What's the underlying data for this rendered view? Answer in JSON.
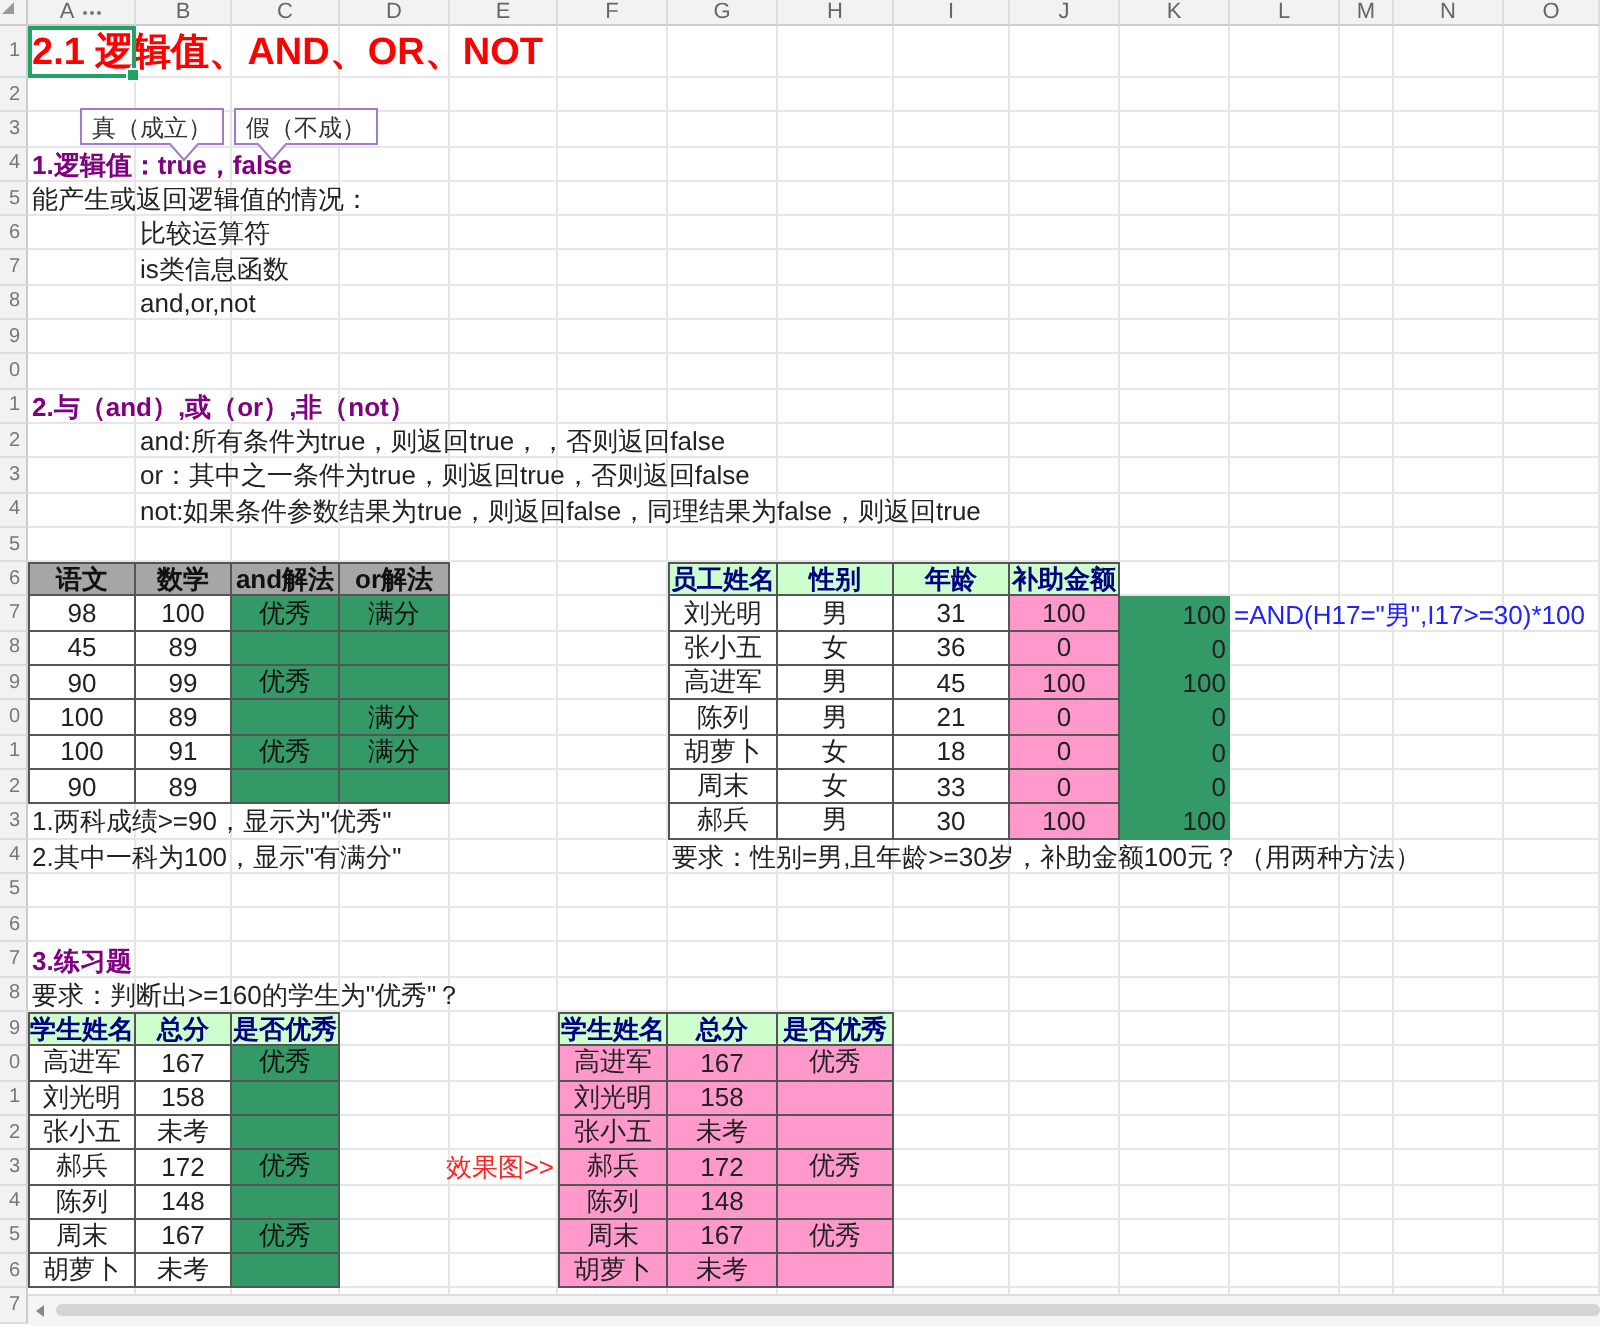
{
  "sheet": {
    "column_headers": [
      "A",
      "B",
      "C",
      "D",
      "E",
      "F",
      "G",
      "H",
      "I",
      "J",
      "K",
      "L",
      "M",
      "N",
      "O"
    ],
    "row_headers": [
      "1",
      "2",
      "3",
      "4",
      "5",
      "6",
      "7",
      "8",
      "9",
      "0",
      "1",
      "2",
      "3",
      "4",
      "5",
      "6",
      "7",
      "8",
      "9",
      "0",
      "1",
      "2",
      "3",
      "4",
      "5",
      "6",
      "7",
      "8",
      "9",
      "0",
      "1",
      "2",
      "3",
      "4",
      "5",
      "6",
      "7"
    ]
  },
  "title": {
    "text": "2.1 逻辑值、AND、OR、NOT",
    "selected": true
  },
  "callouts": [
    "真（成立）",
    "假（不成）"
  ],
  "section_1": {
    "heading": "1.逻辑值：true，false",
    "intro": "能产生或返回逻辑值的情况：",
    "items": [
      "比较运算符",
      "is类信息函数",
      "and,or,not"
    ]
  },
  "section_2": {
    "heading": "2.与（and）,或（or）,非（not）",
    "items": [
      "and:所有条件为true，则返回true，，否则返回false",
      "or：其中之一条件为true，则返回true，否则返回false",
      "not:如果条件参数结果为true，则返回false，同理结果为false，则返回true"
    ]
  },
  "score_table": {
    "columns": [
      "语文",
      "数学",
      "and解法",
      "or解法"
    ],
    "rows": [
      {
        "chinese": "98",
        "math": "100",
        "and_result": "优秀",
        "or_result": "满分"
      },
      {
        "chinese": "45",
        "math": "89"
      },
      {
        "chinese": "90",
        "math": "99",
        "and_result": "优秀"
      },
      {
        "chinese": "100",
        "math": "89",
        "or_result": "满分"
      },
      {
        "chinese": "100",
        "math": "91",
        "and_result": "优秀",
        "or_result": "满分"
      },
      {
        "chinese": "90",
        "math": "89"
      }
    ],
    "notes": [
      "1.两科成绩>=90，显示为\"优秀\"",
      "2.其中一科为100，显示\"有满分\""
    ]
  },
  "allowance_table": {
    "columns": [
      "员工姓名",
      "性别",
      "年龄",
      "补助金额"
    ],
    "rows": [
      {
        "name": "刘光明",
        "gender": "男",
        "age": "31",
        "allowance": "100",
        "column_5": "100"
      },
      {
        "name": "张小五",
        "gender": "女",
        "age": "36",
        "allowance": "0",
        "column_5": "0"
      },
      {
        "name": "高进军",
        "gender": "男",
        "age": "45",
        "allowance": "100",
        "column_5": "100"
      },
      {
        "name": "陈列",
        "gender": "男",
        "age": "21",
        "allowance": "0",
        "column_5": "0"
      },
      {
        "name": "胡萝卜",
        "gender": "女",
        "age": "18",
        "allowance": "0",
        "column_5": "0"
      },
      {
        "name": "周末",
        "gender": "女",
        "age": "33",
        "allowance": "0",
        "column_5": "0"
      },
      {
        "name": "郝兵",
        "gender": "男",
        "age": "30",
        "allowance": "100",
        "column_5": "100"
      }
    ],
    "formula": "=AND(H17=\"男\",I17>=30)*100",
    "requirement": "要求：性别=男,且年龄>=30岁，补助金额100元？（用两种方法）"
  },
  "exercise": {
    "heading": "3.练习题",
    "requirement": "要求：判断出>=160的学生为\"优秀\"？",
    "table": {
      "columns": [
        "学生姓名",
        "总分",
        "是否优秀"
      ],
      "rows": [
        {
          "name": "高进军",
          "total": "167",
          "result": "优秀"
        },
        {
          "name": "刘光明",
          "total": "158"
        },
        {
          "name": "张小五",
          "total": "未考"
        },
        {
          "name": "郝兵",
          "total": "172",
          "result": "优秀"
        },
        {
          "name": "陈列",
          "total": "148"
        },
        {
          "name": "周末",
          "total": "167",
          "result": "优秀"
        },
        {
          "name": "胡萝卜",
          "total": "未考"
        }
      ]
    },
    "result_label": "效果图>>",
    "result_table": {
      "columns": [
        "学生姓名",
        "总分",
        "是否优秀"
      ],
      "rows": [
        {
          "name": "高进军",
          "total": "167",
          "result": "优秀"
        },
        {
          "name": "刘光明",
          "total": "158"
        },
        {
          "name": "张小五",
          "total": "未考"
        },
        {
          "name": "郝兵",
          "total": "172",
          "result": "优秀"
        },
        {
          "name": "陈列",
          "total": "148"
        },
        {
          "name": "周末",
          "total": "167",
          "result": "优秀"
        },
        {
          "name": "胡萝卜",
          "total": "未考"
        }
      ]
    }
  }
}
